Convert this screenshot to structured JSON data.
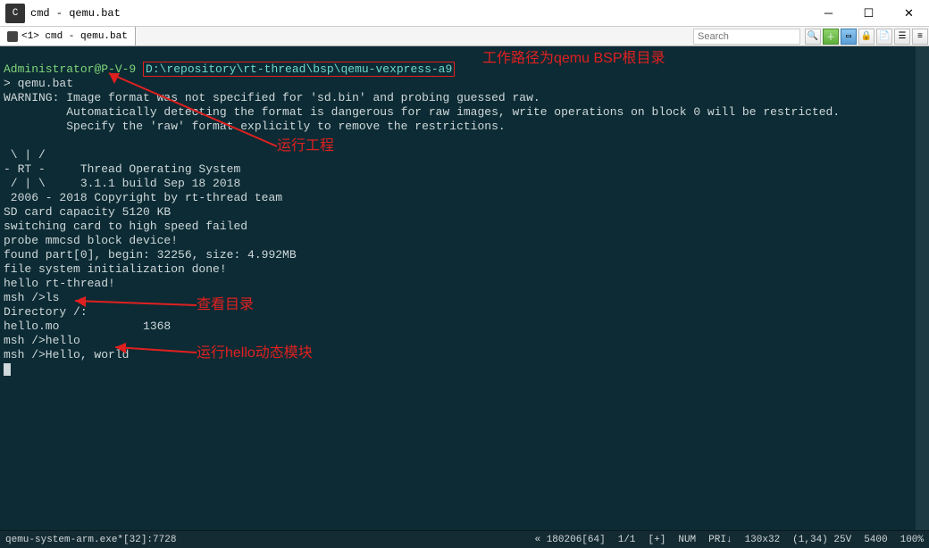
{
  "window": {
    "icon_text": "C",
    "title": "cmd - qemu.bat"
  },
  "tab": {
    "label": "<1> cmd - qemu.bat"
  },
  "search": {
    "placeholder": "Search"
  },
  "terminal": {
    "prompt_user": "Administrator@P-V-9 ",
    "prompt_path": "D:\\repository\\rt-thread\\bsp\\qemu-vexpress-a9",
    "lines": {
      "l0": "> qemu.bat",
      "l1": "WARNING: Image format was not specified for 'sd.bin' and probing guessed raw.",
      "l2": "         Automatically detecting the format is dangerous for raw images, write operations on block 0 will be restricted.",
      "l3": "         Specify the 'raw' format explicitly to remove the restrictions.",
      "l4": "",
      "l5": " \\ | /",
      "l6": "- RT -     Thread Operating System",
      "l7": " / | \\     3.1.1 build Sep 18 2018",
      "l8": " 2006 - 2018 Copyright by rt-thread team",
      "l9": "SD card capacity 5120 KB",
      "l10": "switching card to high speed failed",
      "l11": "probe mmcsd block device!",
      "l12": "found part[0], begin: 32256, size: 4.992MB",
      "l13": "file system initialization done!",
      "l14": "hello rt-thread!",
      "l15": "msh />ls",
      "l16": "Directory /:",
      "l17": "hello.mo            1368",
      "l18": "msh />hello",
      "l19": "msh />Hello, world"
    }
  },
  "annotations": {
    "a1": "工作路径为qemu BSP根目录",
    "a2": "运行工程",
    "a3": "查看目录",
    "a4": "运行hello动态模块"
  },
  "status": {
    "left": "qemu-system-arm.exe*[32]:7728",
    "s1": "« 180206[64]",
    "s2": "1/1",
    "s3": "[+]",
    "s4": "NUM",
    "s5": "PRI↓",
    "s6": "130x32",
    "s7": "(1,34) 25V",
    "s8": "5400",
    "s9": "100%"
  }
}
